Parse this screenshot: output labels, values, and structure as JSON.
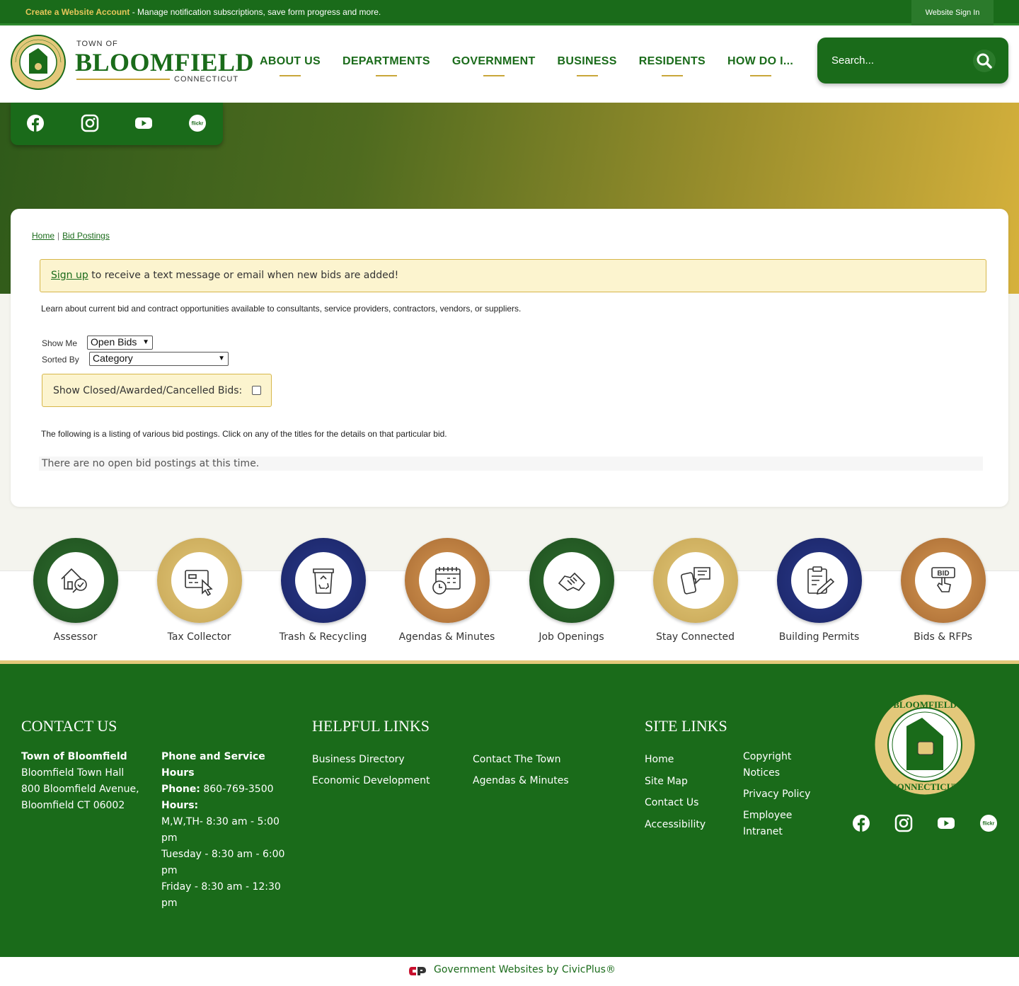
{
  "topbar": {
    "create_link": "Create a Website Account",
    "message": " - Manage notification subscriptions, save form progress and more.",
    "signin": "Website Sign In"
  },
  "header": {
    "brand_top": "TOWN OF",
    "brand_main": "BLOOMFIELD",
    "brand_sub": "CONNECTICUT",
    "nav": [
      "ABOUT US",
      "DEPARTMENTS",
      "GOVERNMENT",
      "BUSINESS",
      "RESIDENTS",
      "HOW DO I..."
    ],
    "search_placeholder": "Search..."
  },
  "social_icons": [
    "facebook-icon",
    "instagram-icon",
    "youtube-icon",
    "flickr-icon"
  ],
  "breadcrumb": {
    "home": "Home",
    "current": "Bid Postings",
    "sep": "|"
  },
  "alert": {
    "link": "Sign up",
    "text": " to receive a text message or email when new bids are added!"
  },
  "intro": "Learn about current bid and contract opportunities available to consultants, service providers, contractors, vendors, or suppliers.",
  "filters": {
    "show_me_label": "Show Me",
    "show_me_value": "Open Bids",
    "sorted_by_label": "Sorted By",
    "sorted_by_value": "Category",
    "closed_label": "Show Closed/Awarded/Cancelled Bids:"
  },
  "listing_note": "The following is a listing of various bid postings. Click on any of the titles for the details on that particular bid.",
  "no_results": "There are no open bid postings at this time.",
  "quick_links": [
    {
      "label": "Assessor",
      "color": "green",
      "icon": "house-magnifier-icon"
    },
    {
      "label": "Tax Collector",
      "color": "gold",
      "icon": "card-cursor-icon"
    },
    {
      "label": "Trash & Recycling",
      "color": "navy",
      "icon": "recycle-bin-icon"
    },
    {
      "label": "Agendas & Minutes",
      "color": "copper",
      "icon": "calendar-clock-icon"
    },
    {
      "label": "Job Openings",
      "color": "green",
      "icon": "handshake-icon"
    },
    {
      "label": "Stay Connected",
      "color": "gold",
      "icon": "phone-chat-icon"
    },
    {
      "label": "Building Permits",
      "color": "navy",
      "icon": "clipboard-pen-icon"
    },
    {
      "label": "Bids & RFPs",
      "color": "copper",
      "icon": "bid-hand-icon"
    }
  ],
  "footer": {
    "contact_heading": "CONTACT US",
    "org_name": "Town of Bloomfield",
    "address_line1": "Bloomfield Town Hall",
    "address_line2": "800 Bloomfield Avenue,",
    "address_line3": "Bloomfield CT 06002",
    "hours_heading": "Phone and Service Hours",
    "phone_label": "Phone:",
    "phone": " 860-769-3500",
    "hours_label": "Hours:",
    "hours_1": "M,W,TH- 8:30 am - 5:00 pm",
    "hours_2": "Tuesday - 8:30 am - 6:00 pm",
    "hours_3": "Friday - 8:30 am - 12:30 pm",
    "helpful_heading": "HELPFUL LINKS",
    "helpful_col1": [
      "Business Directory",
      "Economic Development"
    ],
    "helpful_col2": [
      "Contact The Town",
      "Agendas & Minutes"
    ],
    "site_heading": "SITE LINKS",
    "site_col1": [
      "Home",
      "Site Map",
      "Contact Us",
      "Accessibility"
    ],
    "site_col2": [
      "Copyright Notices",
      "Privacy Policy",
      "Employee Intranet"
    ],
    "civicplus": "Government Websites by CivicPlus®"
  },
  "colors": {
    "brand_green": "#1a6b1a",
    "gold": "#c9a63a",
    "navy": "#1a2466",
    "copper": "#a86a32"
  }
}
